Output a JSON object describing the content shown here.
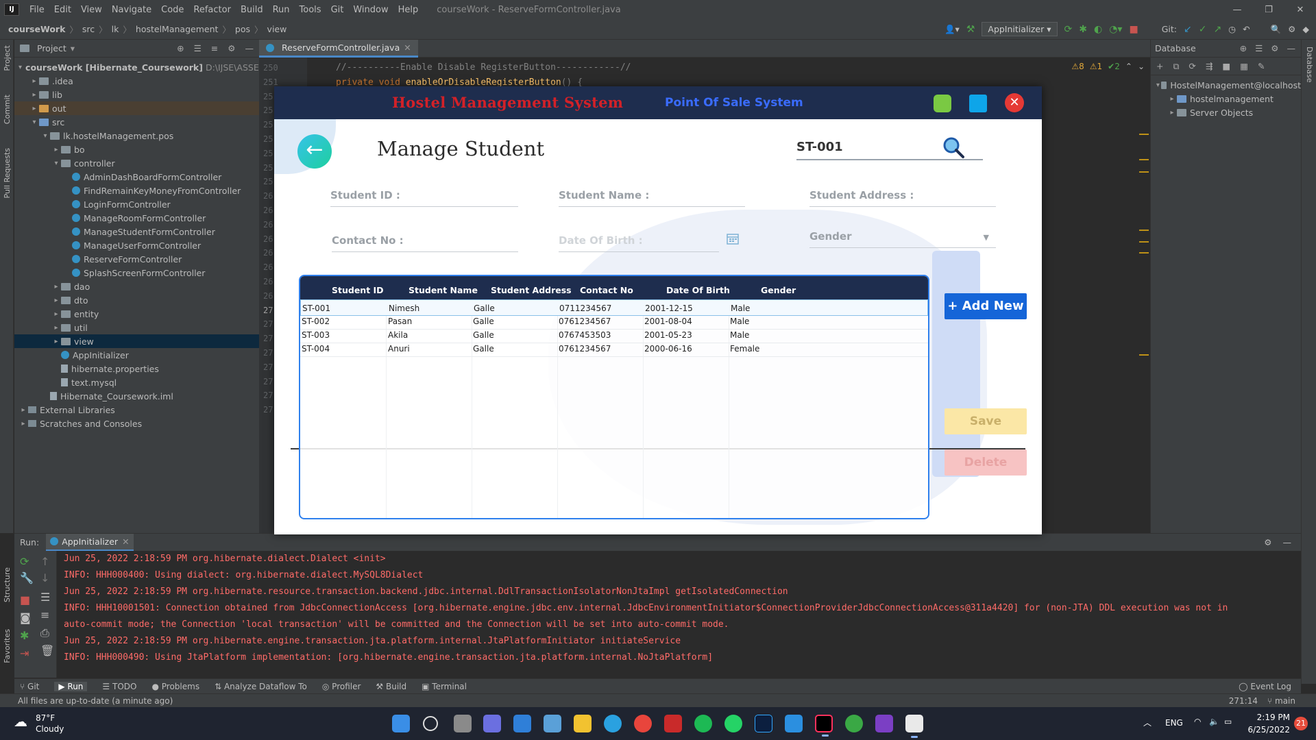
{
  "ide": {
    "menu": [
      "File",
      "Edit",
      "View",
      "Navigate",
      "Code",
      "Refactor",
      "Build",
      "Run",
      "Tools",
      "Git",
      "Window",
      "Help"
    ],
    "window_title": "courseWork - ReserveFormController.java",
    "breadcrumb": [
      "courseWork",
      "src",
      "lk",
      "hostelManagement",
      "pos",
      "view"
    ],
    "run_config": "AppInitializer",
    "git_label": "Git:",
    "project_panel_title": "Project",
    "tree": [
      {
        "label": "courseWork [Hibernate_Coursework]",
        "extra": "D:\\IJSE\\ASSEGEMEN",
        "indent": 0,
        "icon": "dir",
        "arrow": "▾"
      },
      {
        "label": ".idea",
        "indent": 1,
        "icon": "dir",
        "arrow": "▸"
      },
      {
        "label": "lib",
        "indent": 1,
        "icon": "dir",
        "arrow": "▸"
      },
      {
        "label": "out",
        "indent": 1,
        "icon": "dir orange",
        "arrow": "▸",
        "hl": true
      },
      {
        "label": "src",
        "indent": 1,
        "icon": "dir blue",
        "arrow": "▾"
      },
      {
        "label": "lk.hostelManagement.pos",
        "indent": 2,
        "icon": "dir",
        "arrow": "▾"
      },
      {
        "label": "bo",
        "indent": 3,
        "icon": "dir",
        "arrow": "▸"
      },
      {
        "label": "controller",
        "indent": 3,
        "icon": "dir",
        "arrow": "▾"
      },
      {
        "label": "AdminDashBoardFormController",
        "indent": 4,
        "icon": "cls",
        "arrow": ""
      },
      {
        "label": "FindRemainKeyMoneyFromController",
        "indent": 4,
        "icon": "cls",
        "arrow": ""
      },
      {
        "label": "LoginFormController",
        "indent": 4,
        "icon": "cls",
        "arrow": ""
      },
      {
        "label": "ManageRoomFormController",
        "indent": 4,
        "icon": "cls",
        "arrow": ""
      },
      {
        "label": "ManageStudentFormController",
        "indent": 4,
        "icon": "cls",
        "arrow": ""
      },
      {
        "label": "ManageUserFormController",
        "indent": 4,
        "icon": "cls",
        "arrow": ""
      },
      {
        "label": "ReserveFormController",
        "indent": 4,
        "icon": "cls",
        "arrow": ""
      },
      {
        "label": "SplashScreenFormController",
        "indent": 4,
        "icon": "cls",
        "arrow": ""
      },
      {
        "label": "dao",
        "indent": 3,
        "icon": "dir",
        "arrow": "▸"
      },
      {
        "label": "dto",
        "indent": 3,
        "icon": "dir",
        "arrow": "▸"
      },
      {
        "label": "entity",
        "indent": 3,
        "icon": "dir",
        "arrow": "▸"
      },
      {
        "label": "util",
        "indent": 3,
        "icon": "dir",
        "arrow": "▸"
      },
      {
        "label": "view",
        "indent": 3,
        "icon": "dir",
        "arrow": "▸",
        "sel": true
      },
      {
        "label": "AppInitializer",
        "indent": 3,
        "icon": "cls",
        "arrow": ""
      },
      {
        "label": "hibernate.properties",
        "indent": 3,
        "icon": "file",
        "arrow": ""
      },
      {
        "label": "text.mysql",
        "indent": 3,
        "icon": "file",
        "arrow": ""
      },
      {
        "label": "Hibernate_Coursework.iml",
        "indent": 2,
        "icon": "file",
        "arrow": ""
      },
      {
        "label": "External Libraries",
        "indent": 0,
        "icon": "lib",
        "arrow": "▸"
      },
      {
        "label": "Scratches and Consoles",
        "indent": 0,
        "icon": "lib",
        "arrow": "▸"
      }
    ],
    "editor_tab": "ReserveFormController.java",
    "line_numbers": [
      "250",
      "251",
      "25",
      "25",
      "25",
      "25",
      "25",
      "25",
      "25",
      "26",
      "26",
      "26",
      "26",
      "26",
      "26",
      "26",
      "26",
      "27",
      "27",
      "27",
      "27",
      "27",
      "27",
      "27",
      "27"
    ],
    "code_line1": "//----------Enable Disable RegisterButton------------//",
    "code_line2_kw": "private void",
    "code_line2_fn": "enableOrDisableRegisterButton",
    "code_line2_rest": "() {",
    "inspections": [
      "⚠8",
      "⚠1",
      "✔2"
    ],
    "db_panel_title": "Database",
    "db_tree": [
      {
        "label": "HostelManagement@localhost",
        "indent": 0
      },
      {
        "label": "hostelmanagement",
        "indent": 1
      },
      {
        "label": "Server Objects",
        "indent": 1
      }
    ],
    "run_label": "Run:",
    "run_tab": "AppInitializer",
    "console": [
      "Jun 25, 2022 2:18:59 PM org.hibernate.dialect.Dialect <init>",
      "INFO: HHH000400: Using dialect: org.hibernate.dialect.MySQL8Dialect",
      "Jun 25, 2022 2:18:59 PM org.hibernate.resource.transaction.backend.jdbc.internal.DdlTransactionIsolatorNonJtaImpl getIsolatedConnection",
      "INFO: HHH10001501: Connection obtained from JdbcConnectionAccess [org.hibernate.engine.jdbc.env.internal.JdbcEnvironmentInitiator$ConnectionProviderJdbcConnectionAccess@311a4420] for (non-JTA) DDL execution was not in",
      " auto-commit mode; the Connection 'local transaction' will be committed and the Connection will be set into auto-commit mode.",
      "Jun 25, 2022 2:18:59 PM org.hibernate.engine.transaction.jta.platform.internal.JtaPlatformInitiator initiateService",
      "INFO: HHH000490: Using JtaPlatform implementation: [org.hibernate.engine.transaction.jta.platform.internal.NoJtaPlatform]"
    ],
    "bottom_tabs": [
      "Git",
      "Run",
      "TODO",
      "Problems",
      "Analyze Dataflow To",
      "Profiler",
      "Build",
      "Terminal"
    ],
    "event_log": "Event Log",
    "status_message": "All files are up-to-date (a minute ago)",
    "cursor_pos": "271:14",
    "branch": "main",
    "left_stripe": [
      "Project",
      "Commit",
      "Pull Requests",
      "Structure",
      "Favorites"
    ],
    "right_stripe": [
      "Database"
    ]
  },
  "app": {
    "title": "Hostel Management System",
    "subtitle": "Point Of Sale System",
    "page_title": "Manage Student",
    "search_value": "ST-001",
    "fields": {
      "student_id": "Student ID :",
      "student_name": "Student Name :",
      "student_address": "Student Address :",
      "contact_no": "Contact No :",
      "dob": "Date Of Birth :",
      "gender": "Gender"
    },
    "table": {
      "columns": [
        "Student ID",
        "Student Name",
        "Student Address",
        "Contact No",
        "Date Of Birth",
        "Gender"
      ],
      "rows": [
        [
          "ST-001",
          "Nimesh",
          "Galle",
          "0711234567",
          "2001-12-15",
          "Male"
        ],
        [
          "ST-002",
          "Pasan",
          "Galle",
          "0761234567",
          "2001-08-04",
          "Male"
        ],
        [
          "ST-003",
          "Akila",
          "Galle",
          "0767453503",
          "2001-05-23",
          "Male"
        ],
        [
          "ST-004",
          "Anuri",
          "Galle",
          "0761234567",
          "2000-06-16",
          "Female"
        ]
      ]
    },
    "buttons": {
      "add_new": "+ Add New",
      "save": "Save",
      "delete": "Delete"
    }
  },
  "taskbar": {
    "temperature": "87°F",
    "weather": "Cloudy",
    "lang": "ENG",
    "time": "2:19 PM",
    "date": "6/25/2022",
    "notifications": "21"
  }
}
